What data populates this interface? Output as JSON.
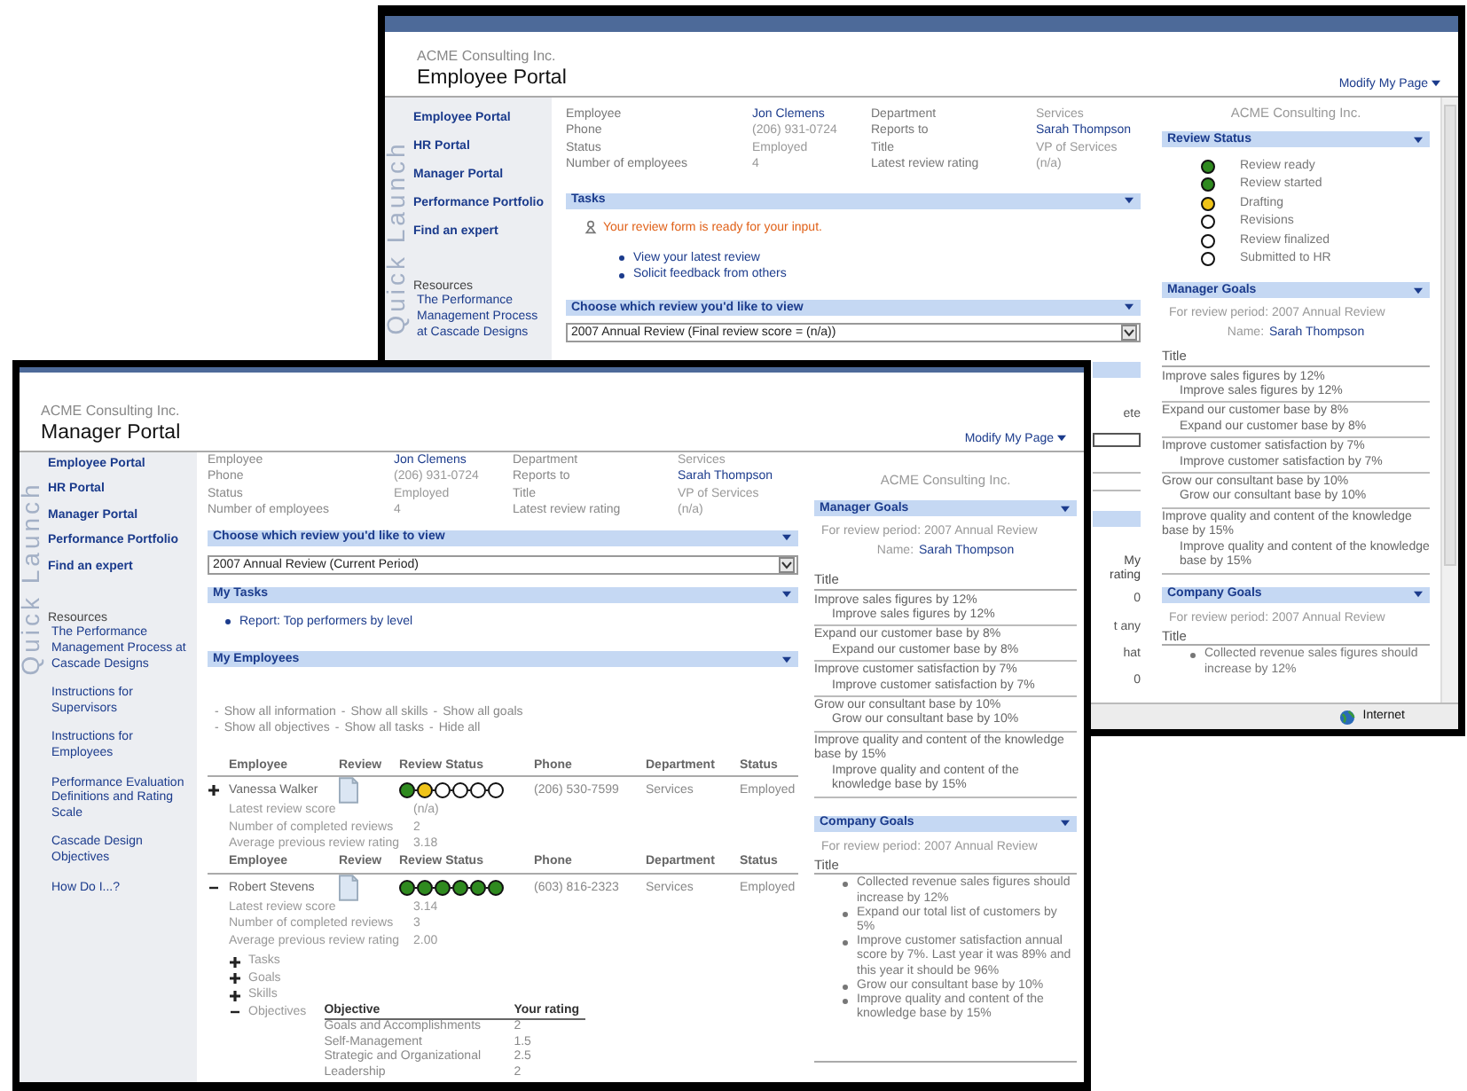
{
  "employee_window": {
    "header": {
      "company": "ACME Consulting Inc.",
      "title": "Employee Portal",
      "modify_link": "Modify My Page"
    },
    "quick_launch_label": "Quick Launch",
    "nav": [
      "Employee Portal",
      "HR Portal",
      "Manager Portal",
      "Performance Portfolio",
      "Find an expert"
    ],
    "resources": {
      "heading": "Resources",
      "links": [
        "The Performance Management Process at Cascade Designs"
      ]
    },
    "profile": [
      {
        "label": "Employee",
        "value": "Jon Clemens",
        "kind": "link"
      },
      {
        "label": "Department",
        "value": "Services",
        "kind": "text"
      },
      {
        "label": "Phone",
        "value": "(206) 931-0724",
        "kind": "text"
      },
      {
        "label": "Reports to",
        "value": "Sarah Thompson",
        "kind": "link"
      },
      {
        "label": "Status",
        "value": "Employed",
        "kind": "text"
      },
      {
        "label": "Title",
        "value": "VP of Services",
        "kind": "text"
      },
      {
        "label": "Number of employees",
        "value": "4",
        "kind": "text"
      },
      {
        "label": "Latest review rating",
        "value": "(n/a)",
        "kind": "text"
      }
    ],
    "tasks": {
      "title": "Tasks",
      "alert": "Your review form is ready for your input.",
      "links": [
        "View your latest review",
        "Solicit feedback from others"
      ]
    },
    "review_choice": {
      "title": "Choose which review you'd like to view",
      "value": "2007 Annual Review (Final review score = (n/a))"
    },
    "partial_column": [
      {
        "kind": "bar"
      },
      {
        "kind": "text",
        "text": "ete"
      },
      {
        "kind": "field"
      },
      {
        "kind": "rule"
      },
      {
        "kind": "rule"
      },
      {
        "kind": "bar"
      },
      {
        "kind": "head",
        "text": "My rating"
      },
      {
        "kind": "text",
        "text": "0"
      },
      {
        "kind": "text",
        "text": "t any"
      },
      {
        "kind": "text",
        "text": "hat"
      },
      {
        "kind": "text",
        "text": "0"
      }
    ],
    "right": {
      "company": "ACME Consulting Inc.",
      "review_status": {
        "title": "Review Status",
        "steps": [
          {
            "label": "Review ready",
            "color": "#2f8a1f"
          },
          {
            "label": "Review started",
            "color": "#2f8a1f"
          },
          {
            "label": "Drafting",
            "color": "#f0c419"
          },
          {
            "label": "Revisions",
            "color": "#ffffff"
          },
          {
            "label": "Review finalized",
            "color": "#ffffff"
          },
          {
            "label": "Submitted to HR",
            "color": "#ffffff"
          }
        ]
      },
      "manager_goals": {
        "title": "Manager Goals",
        "period": "For review period: 2007 Annual Review",
        "name_label": "Name:",
        "name": "Sarah Thompson",
        "column": "Title",
        "goals": [
          {
            "goal": "Improve sales figures by 12%",
            "detail": "Improve sales figures by 12%"
          },
          {
            "goal": "Expand our customer base by 8%",
            "detail": "Expand our customer base by 8%"
          },
          {
            "goal": "Improve customer satisfaction by 7%",
            "detail": "Improve customer satisfaction by 7%"
          },
          {
            "goal": "Grow our consultant base by 10%",
            "detail": "Grow our consultant base by 10%"
          },
          {
            "goal": "Improve quality and content of the knowledge base by 15%",
            "detail": "Improve quality and content of the knowledge base by 15%"
          }
        ]
      },
      "company_goals": {
        "title": "Company Goals",
        "period": "For review period: 2007 Annual Review",
        "column": "Title",
        "items": [
          "Collected revenue sales figures should increase by 12%"
        ]
      }
    },
    "status_bar": {
      "zone": "Internet"
    }
  },
  "manager_window": {
    "header": {
      "company": "ACME Consulting Inc.",
      "title": "Manager Portal",
      "modify_link": "Modify My Page"
    },
    "quick_launch_label": "Quick Launch",
    "nav": [
      "Employee Portal",
      "HR Portal",
      "Manager Portal",
      "Performance Portfolio",
      "Find an expert"
    ],
    "resources": {
      "heading": "Resources",
      "links": [
        "The Performance Management Process at Cascade Designs",
        "Instructions for Supervisors",
        "Instructions for Employees",
        "Performance Evaluation Definitions and Rating Scale",
        "Cascade Design Objectives",
        "How Do I...?"
      ]
    },
    "profile": [
      {
        "label": "Employee",
        "value": "Jon Clemens",
        "kind": "link"
      },
      {
        "label": "Department",
        "value": "Services",
        "kind": "text"
      },
      {
        "label": "Phone",
        "value": "(206) 931-0724",
        "kind": "text"
      },
      {
        "label": "Reports to",
        "value": "Sarah Thompson",
        "kind": "link"
      },
      {
        "label": "Status",
        "value": "Employed",
        "kind": "text"
      },
      {
        "label": "Title",
        "value": "VP of Services",
        "kind": "text"
      },
      {
        "label": "Number of employees",
        "value": "4",
        "kind": "text"
      },
      {
        "label": "Latest review rating",
        "value": "(n/a)",
        "kind": "text"
      }
    ],
    "review_choice": {
      "title": "Choose which review you'd like to view",
      "value": "2007 Annual Review (Current Period)"
    },
    "my_tasks": {
      "title": "My Tasks",
      "links": [
        "Report: Top performers by level"
      ]
    },
    "my_employees": {
      "title": "My Employees",
      "separator": "-",
      "link_rows": [
        [
          "Show all information",
          "Show all skills",
          "Show all goals"
        ],
        [
          "Show all objectives",
          "Show all tasks",
          "Hide all"
        ]
      ],
      "employees": [
        {
          "columns": [
            "Employee",
            "Review",
            "Review Status",
            "Phone",
            "Department",
            "Status"
          ],
          "expanded": false,
          "name": "Vanessa Walker",
          "stages": [
            {
              "color": "#2f8a1f"
            },
            {
              "color": "#f0c419"
            },
            {
              "color": "#ffffff"
            },
            {
              "color": "#ffffff"
            },
            {
              "color": "#ffffff"
            },
            {
              "color": "#ffffff"
            }
          ],
          "phone": "(206) 530-7599",
          "department": "Services",
          "status": "Employed",
          "details": [
            {
              "label": "Latest review score",
              "value": "(n/a)"
            },
            {
              "label": "Number of completed reviews",
              "value": "2"
            },
            {
              "label": "Average previous review rating",
              "value": "3.18"
            }
          ]
        },
        {
          "columns": [
            "Employee",
            "Review",
            "Review Status",
            "Phone",
            "Department",
            "Status"
          ],
          "expanded": true,
          "name": "Robert Stevens",
          "stages": [
            {
              "color": "#2f8a1f"
            },
            {
              "color": "#2f8a1f"
            },
            {
              "color": "#2f8a1f"
            },
            {
              "color": "#2f8a1f"
            },
            {
              "color": "#2f8a1f"
            },
            {
              "color": "#2f8a1f"
            }
          ],
          "phone": "(603) 816-2323",
          "department": "Services",
          "status": "Employed",
          "details": [
            {
              "label": "Latest review score",
              "value": "3.14"
            },
            {
              "label": "Number of completed reviews",
              "value": "3"
            },
            {
              "label": "Average previous review rating",
              "value": "2.00"
            }
          ],
          "sections": [
            {
              "label": "Tasks",
              "expanded": false
            },
            {
              "label": "Goals",
              "expanded": false
            },
            {
              "label": "Skills",
              "expanded": false
            },
            {
              "label": "Objectives",
              "expanded": true
            }
          ],
          "objectives": {
            "columns": [
              "Objective",
              "Your rating"
            ],
            "rows": [
              {
                "objective": "Goals and Accomplishments",
                "rating": "2"
              },
              {
                "objective": "Self-Management",
                "rating": "1.5"
              },
              {
                "objective": "Strategic and Organizational",
                "rating": "2.5"
              },
              {
                "objective": "Leadership",
                "rating": "2"
              }
            ]
          }
        }
      ]
    },
    "right": {
      "company": "ACME Consulting Inc.",
      "manager_goals": {
        "title": "Manager Goals",
        "period": "For review period: 2007 Annual Review",
        "name_label": "Name:",
        "name": "Sarah Thompson",
        "column": "Title",
        "goals": [
          {
            "goal": "Improve sales figures by 12%",
            "detail": "Improve sales figures by 12%"
          },
          {
            "goal": "Expand our customer base by 8%",
            "detail": "Expand our customer base by 8%"
          },
          {
            "goal": "Improve customer satisfaction by 7%",
            "detail": "Improve customer satisfaction by 7%"
          },
          {
            "goal": "Grow our consultant base by 10%",
            "detail": "Grow our consultant base by 10%"
          },
          {
            "goal": "Improve quality and content of the knowledge base by 15%",
            "detail": "Improve quality and content of the knowledge base by 15%"
          }
        ]
      },
      "company_goals": {
        "title": "Company Goals",
        "period": "For review period: 2007 Annual Review",
        "column": "Title",
        "items": [
          "Collected revenue sales figures should increase by 12%",
          "Expand our total list of customers by 5%",
          "Improve customer satisfaction annual score by 7%. Last year it was 89% and this year it should be 96%",
          "Grow our consultant base by 10%",
          "Improve quality and content of the knowledge base by 15%"
        ]
      }
    }
  }
}
